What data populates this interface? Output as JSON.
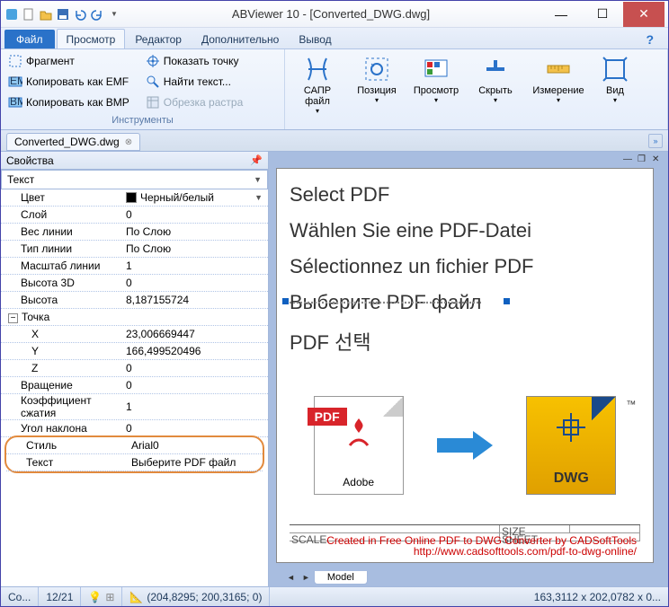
{
  "title": "ABViewer 10 - [Converted_DWG.dwg]",
  "ribbon": {
    "tabs": {
      "file": "Файл",
      "view": "Просмотр",
      "editor": "Редактор",
      "extra": "Дополнительно",
      "output": "Вывод"
    },
    "grp_tools_label": "Инструменты",
    "tools": {
      "fragment": "Фрагмент",
      "copy_emf": "Копировать как EMF",
      "copy_bmp": "Копировать как BMP",
      "show_point": "Показать точку",
      "find_text": "Найти текст...",
      "trim_raster": "Обрезка растра"
    },
    "big": {
      "cad_file": "САПР файл",
      "position": "Позиция",
      "view": "Просмотр",
      "hide": "Скрыть",
      "measure": "Измерение",
      "viewport": "Вид"
    }
  },
  "doc_tab": "Converted_DWG.dwg",
  "panel": {
    "title": "Свойства",
    "object_type": "Текст",
    "rows": {
      "color": "Цвет",
      "color_val": "Черный/белый",
      "layer": "Слой",
      "layer_val": "0",
      "lineweight": "Вес линии",
      "lineweight_val": "По Слою",
      "linetype": "Тип линии",
      "linetype_val": "По Слою",
      "linescale": "Масштаб линии",
      "linescale_val": "1",
      "height3d": "Высота 3D",
      "height3d_val": "0",
      "height": "Высота",
      "height_val": "8,187155724",
      "point_group": "Точка",
      "x": "X",
      "x_val": "23,006669447",
      "y": "Y",
      "y_val": "166,499520496",
      "z": "Z",
      "z_val": "0",
      "rotation": "Вращение",
      "rotation_val": "0",
      "squeeze": "Коэффициент сжатия",
      "squeeze_val": "1",
      "oblique": "Угол наклона",
      "oblique_val": "0",
      "style": "Стиль",
      "style_val": "Arial0",
      "text": "Текст",
      "text_val": "Выберите PDF файл"
    }
  },
  "canvas_text": {
    "l1": "Select PDF",
    "l2": "Wählen Sie eine PDF-Datei",
    "l3": "Sélectionnez un fichier PDF",
    "l4": "Выберите PDF файл",
    "l5": "PDF 선택"
  },
  "pdf_label": "PDF",
  "adobe_label": "Adobe",
  "dwg_label": "DWG",
  "tm": "™",
  "credit1": "Created in Free Online PDF to DWG Converter by CADSoftTools",
  "credit2": "http://www.cadsofttools.com/pdf-to-dwg-online/",
  "title_block": {
    "size": "SIZE",
    "sheet": "SHEET",
    "scale": "SCALE"
  },
  "model_tab": "Model",
  "status": {
    "cmd": "Co...",
    "count": "12/21",
    "coords": "(204,8295; 200,3165; 0)",
    "dims": "163,3112 x 202,0782 x 0..."
  }
}
